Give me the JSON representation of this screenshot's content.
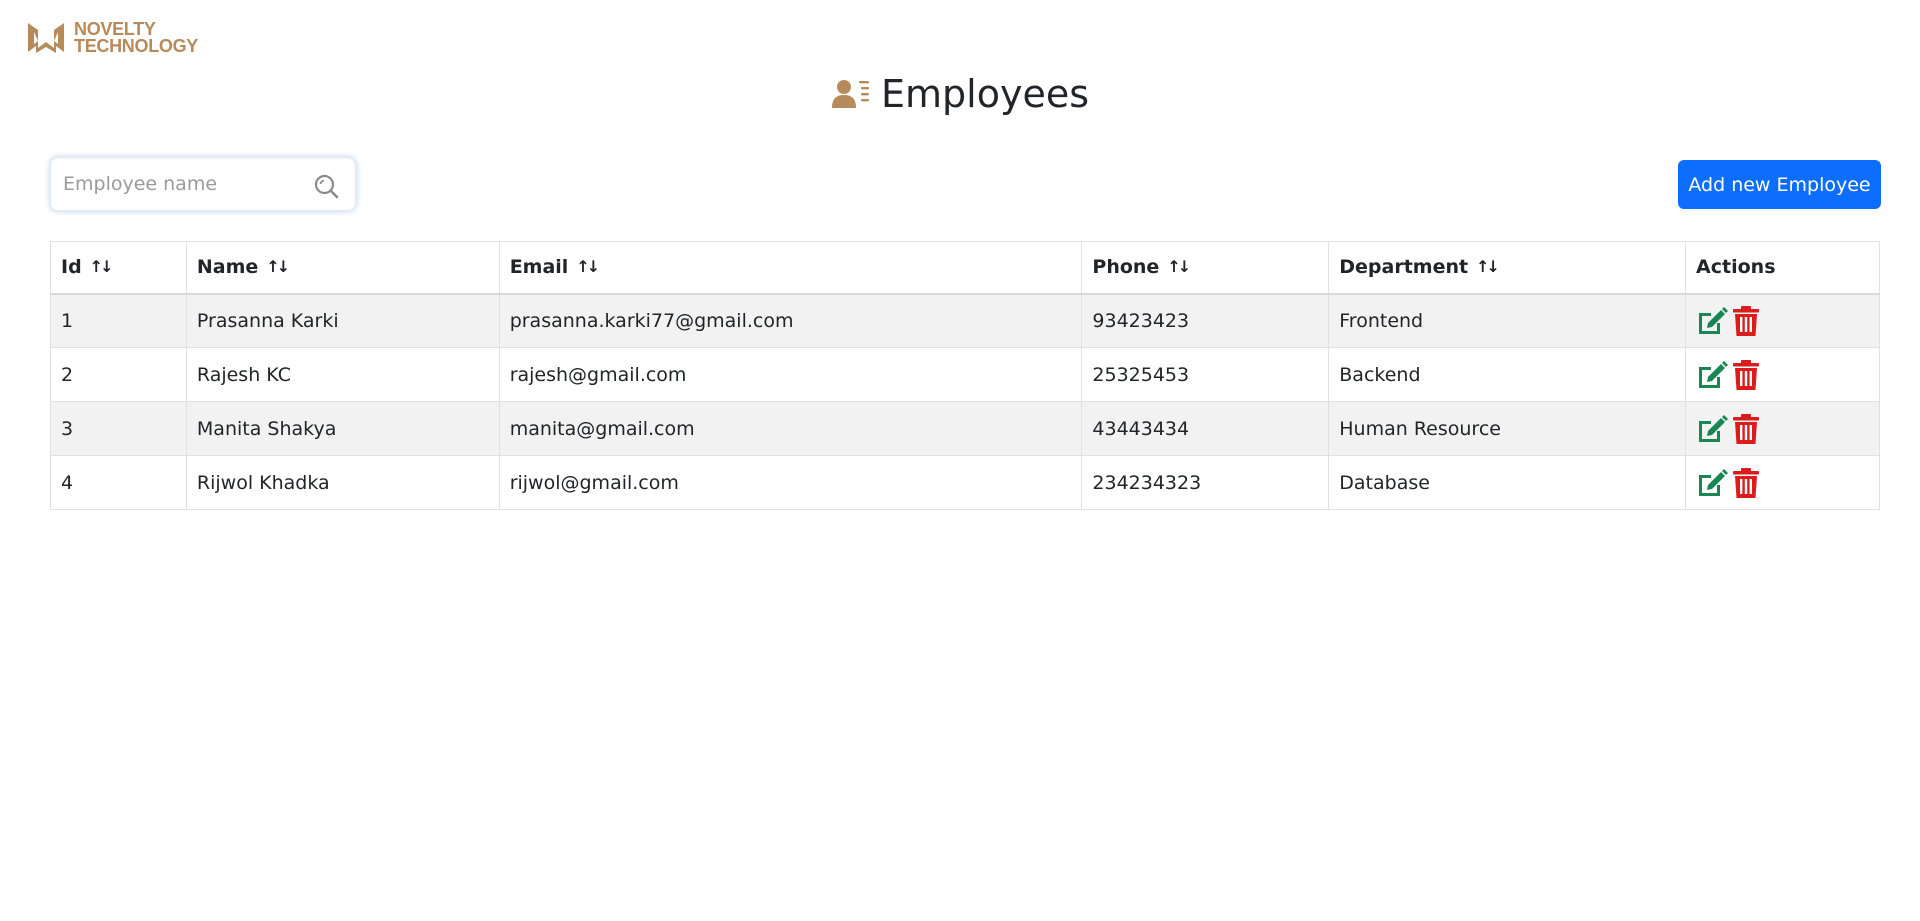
{
  "brand": {
    "line1": "NOVELTY",
    "line2": "TECHNOLOGY",
    "color": "#b68a5a"
  },
  "page": {
    "title": "Employees",
    "title_icon": "employees-list-icon"
  },
  "search": {
    "placeholder": "Employee name",
    "value": "",
    "icon": "search-icon"
  },
  "toolbar": {
    "add_label": "Add new Employee",
    "add_color": "#0d6efd"
  },
  "table": {
    "columns": [
      {
        "label": "Id",
        "sortable": true
      },
      {
        "label": "Name",
        "sortable": true
      },
      {
        "label": "Email",
        "sortable": true
      },
      {
        "label": "Phone",
        "sortable": true
      },
      {
        "label": "Department",
        "sortable": true
      },
      {
        "label": "Actions",
        "sortable": false
      }
    ],
    "sort_glyph": "↑↓",
    "rows": [
      {
        "id": "1",
        "name": "Prasanna Karki",
        "email": "prasanna.karki77@gmail.com",
        "phone": "93423423",
        "department": "Frontend"
      },
      {
        "id": "2",
        "name": "Rajesh KC",
        "email": "rajesh@gmail.com",
        "phone": "25325453",
        "department": "Backend"
      },
      {
        "id": "3",
        "name": "Manita Shakya",
        "email": "manita@gmail.com",
        "phone": "43443434",
        "department": "Human Resource"
      },
      {
        "id": "4",
        "name": "Rijwol Khadka",
        "email": "rijwol@gmail.com",
        "phone": "234234323",
        "department": "Database"
      }
    ],
    "actions": {
      "edit_icon": "edit-icon",
      "delete_icon": "trash-icon",
      "edit_color": "#198754",
      "delete_color": "#dc1c1c"
    }
  }
}
